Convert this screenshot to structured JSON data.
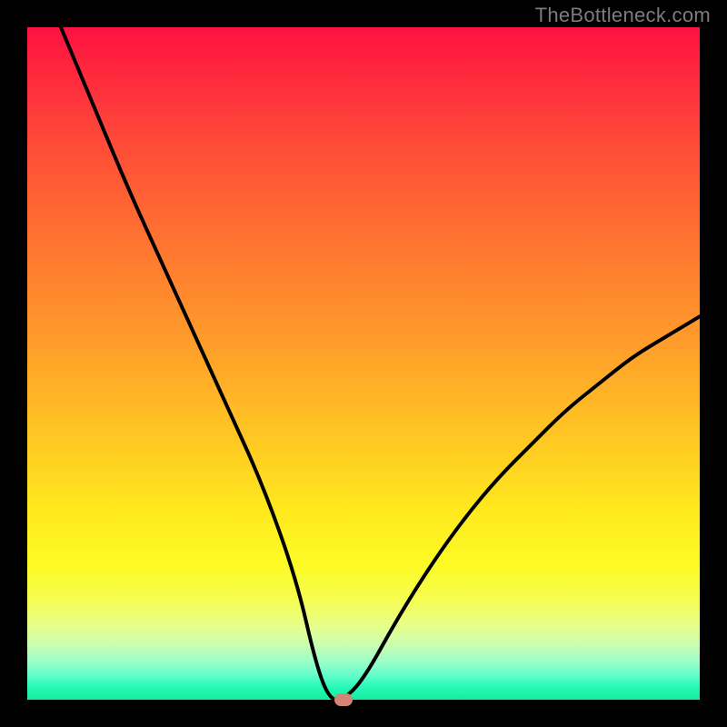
{
  "watermark": "TheBottleneck.com",
  "colors": {
    "frame": "#000000",
    "curve": "#000000",
    "marker": "#d38577",
    "gradient_top": "#fe1240",
    "gradient_bottom": "#12ed9e"
  },
  "chart_data": {
    "type": "line",
    "title": "",
    "xlabel": "",
    "ylabel": "",
    "xlim": [
      0,
      100
    ],
    "ylim": [
      0,
      100
    ],
    "series": [
      {
        "name": "bottleneck-curve",
        "x": [
          5,
          10,
          15,
          20,
          25,
          30,
          35,
          40,
          43,
          45,
          47,
          50,
          55,
          60,
          65,
          70,
          75,
          80,
          85,
          90,
          95,
          100
        ],
        "values": [
          100,
          88,
          76,
          65,
          54,
          43,
          32,
          18,
          5,
          0,
          0,
          3,
          12,
          20,
          27,
          33,
          38,
          43,
          47,
          51,
          54,
          57
        ]
      }
    ],
    "annotations": [
      {
        "name": "optimal-marker",
        "x": 47,
        "y": 0
      }
    ]
  }
}
